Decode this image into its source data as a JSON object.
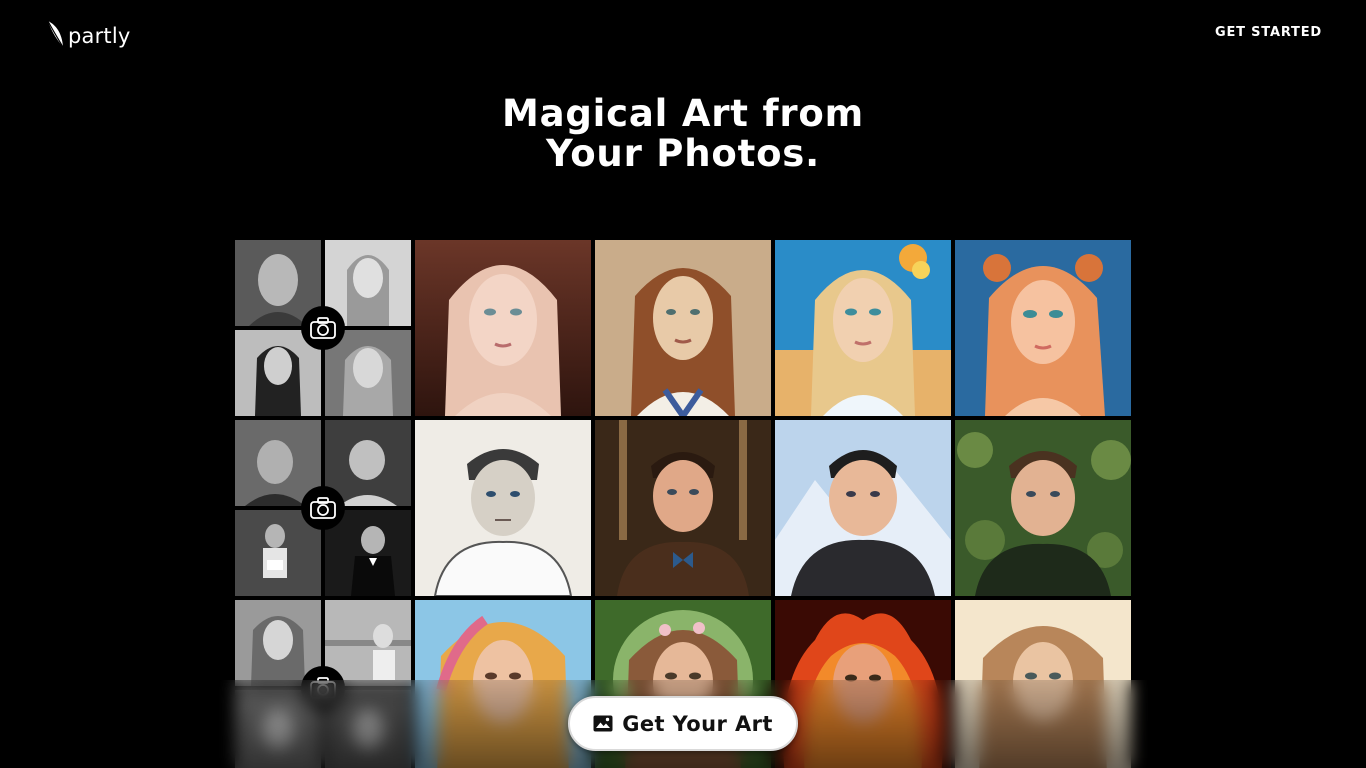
{
  "brand": {
    "name": "partly",
    "logo_icon": "feather-leaf-icon"
  },
  "nav": {
    "cta_label": "GET STARTED"
  },
  "hero": {
    "title_line1": "Magical Art from",
    "title_line2": "Your Photos."
  },
  "gallery": {
    "rows": [
      {
        "subject": "woman-blonde",
        "source_tone": "#8a8a8a",
        "styles": [
          "painted-pink",
          "sepia-portrait",
          "desert-illustration",
          "anime-orange"
        ]
      },
      {
        "subject": "man-short-hair",
        "source_tone": "#6a6a6a",
        "styles": [
          "ink-sketch",
          "steampunk",
          "winter-fur",
          "leafy-background"
        ]
      },
      {
        "subject": "woman-curly",
        "source_tone": "#999999",
        "styles": [
          "rainbow-hair",
          "green-forest",
          "fire",
          "warm-paper"
        ]
      }
    ],
    "camera_icon": "camera-icon"
  },
  "cta": {
    "label": "Get Your Art",
    "icon": "image-icon"
  },
  "colors": {
    "background": "#000000",
    "text": "#ffffff",
    "button_bg": "#ffffff",
    "button_text": "#111111"
  }
}
